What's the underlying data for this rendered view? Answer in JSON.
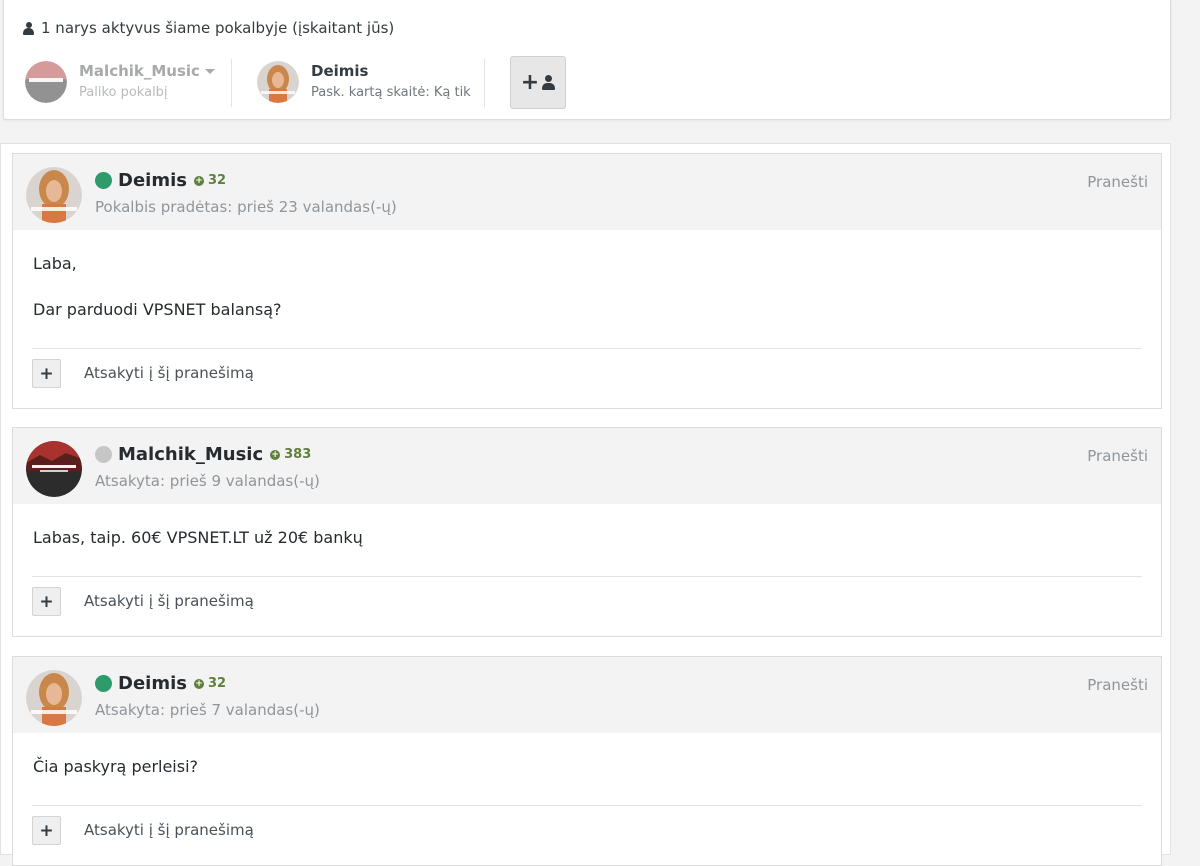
{
  "header": {
    "active_members": "1 narys aktyvus šiame pokalbyje (įskaitant jūs)",
    "participants": [
      {
        "name": "Malchik_Music",
        "status": "Paliko pokalbį"
      },
      {
        "name": "Deimis",
        "status": "Pask. kartą skaitė: Ką tik"
      }
    ]
  },
  "messages": [
    {
      "author": "Deimis",
      "online": true,
      "reputation": "32",
      "meta": "Pokalbis pradėtas: prieš 23 valandas(-ų)",
      "report": "Pranešti",
      "paragraphs": [
        "Laba,",
        "Dar parduodi VPSNET balansą?"
      ],
      "reply_label": "Atsakyti į šį pranešimą"
    },
    {
      "author": "Malchik_Music",
      "online": false,
      "reputation": "383",
      "meta": "Atsakyta: prieš 9 valandas(-ų)",
      "report": "Pranešti",
      "paragraphs": [
        "Labas, taip. 60€ VPSNET.LT už 20€ bankų"
      ],
      "reply_label": "Atsakyti į šį pranešimą"
    },
    {
      "author": "Deimis",
      "online": true,
      "reputation": "32",
      "meta": "Atsakyta: prieš 7 valandas(-ų)",
      "report": "Pranešti",
      "paragraphs": [
        "Čia paskyrą perleisi?"
      ],
      "reply_label": "Atsakyti į šį pranešimą"
    }
  ],
  "colors": {
    "online": "#2f9a6c",
    "offline": "#c6c6c6",
    "reputation": "#5f7f3c"
  },
  "icons": [
    "user-icon",
    "caret-down-icon",
    "add-participant-icon",
    "plus-icon",
    "reputation-plus-icon"
  ]
}
